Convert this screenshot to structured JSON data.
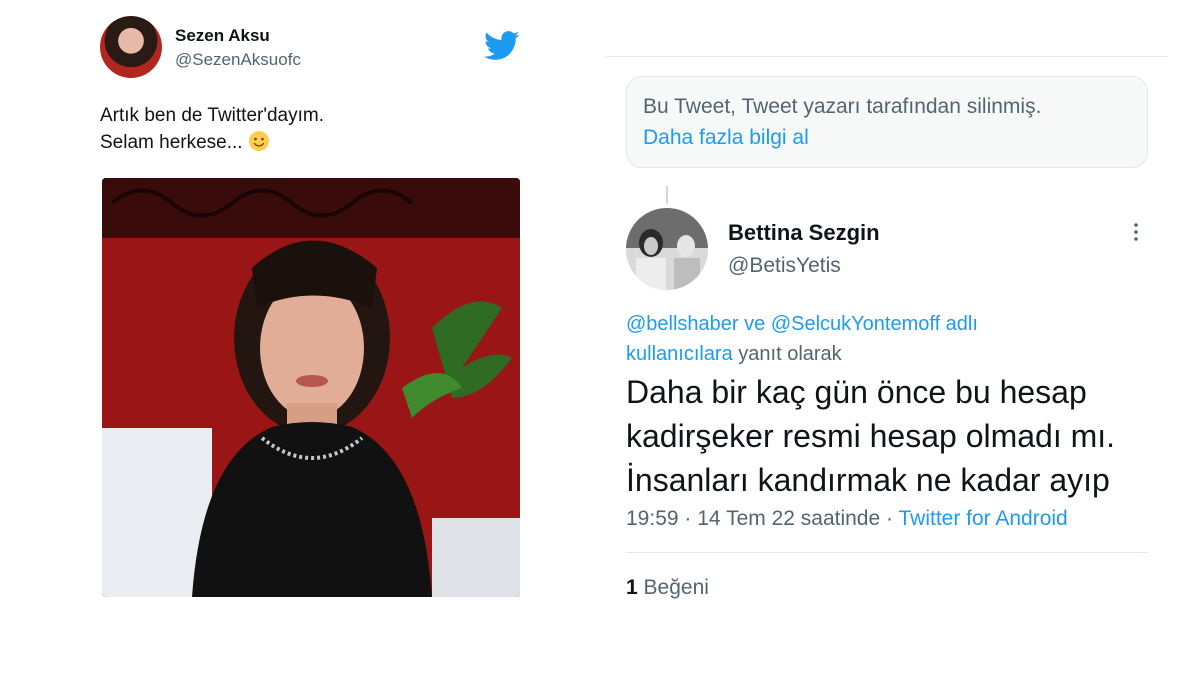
{
  "left_tweet": {
    "name": "Sezen Aksu",
    "handle": "@SezenAksuofc",
    "line1": "Artık ben de Twitter'dayım.",
    "line2": "Selam herkese...",
    "emoji_icon": "slightly-smiling-face-icon",
    "logo_icon": "twitter-bird-icon",
    "brand_color": "#1d9bf0"
  },
  "right_tweet": {
    "deleted_notice": "Bu Tweet, Tweet yazarı tarafından silinmiş.",
    "learn_more": "Daha fazla bilgi al",
    "name": "Bettina Sezgin",
    "handle": "@BetisYetis",
    "reply_prefix_users": "@bellshaber ve @SelcukYontemoff adlı kullanıcılara",
    "reply_suffix": "yanıt olarak",
    "body": "Daha bir kaç gün önce bu hesap kadirşeker resmi hesap olmadı mı. İnsanları kandırmak ne kadar ayıp",
    "time": "19:59",
    "date": "14 Tem 22 saatinde",
    "source": "Twitter for Android",
    "like_count": "1",
    "like_label": "Beğeni",
    "separator": "·"
  }
}
